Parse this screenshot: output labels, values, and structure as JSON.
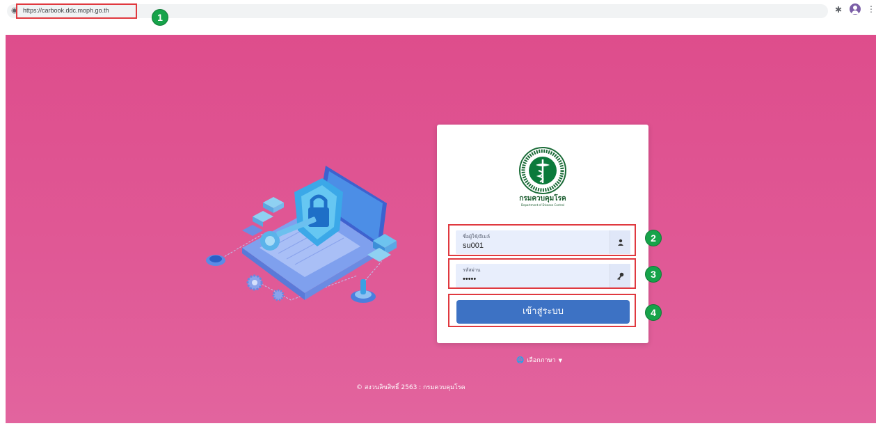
{
  "browser": {
    "url": "https://carbook.ddc.moph.go.th",
    "icons": {
      "site": "globe-icon",
      "extensions": "puzzle-icon",
      "profile": "avatar-icon",
      "menu": "kebab-menu-icon"
    }
  },
  "steps": [
    "1",
    "2",
    "3",
    "4"
  ],
  "card": {
    "org_name_th": "กรมควบคุมโรค",
    "org_name_en": "Department of Disease Control"
  },
  "form": {
    "username": {
      "label": "ชื่อผู้ใช้/อีเมล์",
      "value": "su001",
      "icon": "user-icon"
    },
    "password": {
      "label": "รหัสผ่าน",
      "value": "•••••",
      "icon": "key-icon"
    },
    "login_label": "เข้าสู่ระบบ"
  },
  "language": {
    "label": "เลือกภาษา",
    "icon": "globe-icon"
  },
  "footer": {
    "copyright": "© สงวนลิขสิทธิ์ 2563 : กรมควบคุมโรค"
  },
  "colors": {
    "background": "#de4d8c",
    "button": "#3d72c4",
    "highlight": "#e0393f",
    "badge": "#16a34a"
  }
}
